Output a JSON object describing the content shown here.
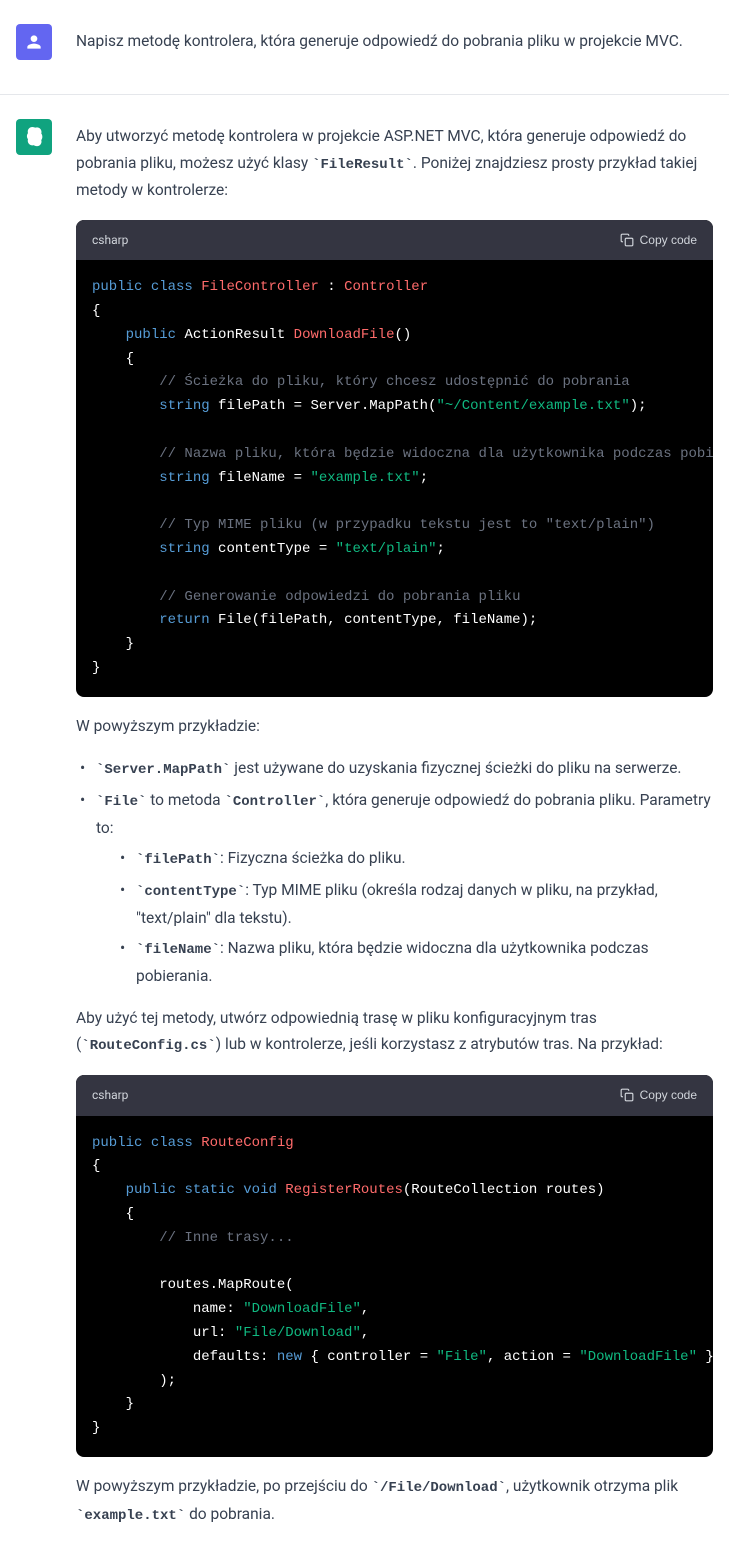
{
  "user": {
    "message": "Napisz metodę kontrolera, która generuje odpowiedź do pobrania pliku w projekcie MVC."
  },
  "assistant": {
    "intro_p1_a": "Aby utworzyć metodę kontrolera w projekcie ASP.NET MVC, która generuje odpowiedź do pobrania pliku, możesz użyć klasy ",
    "intro_p1_code": "`FileResult`",
    "intro_p1_b": ". Poniżej znajdziesz prosty przykład takiej metody w kontrolerze:",
    "code1_lang": "csharp",
    "copy_label": "Copy code",
    "p_after_code1": "W powyższym przykładzie:",
    "bullet1_code": "`Server.MapPath`",
    "bullet1_text": " jest używane do uzyskania fizycznej ścieżki do pliku na serwerze.",
    "bullet2_code": "`File`",
    "bullet2_text_a": " to metoda ",
    "bullet2_code2": "`Controller`",
    "bullet2_text_b": ", która generuje odpowiedź do pobrania pliku. Parametry to:",
    "sub1_code": "`filePath`",
    "sub1_text": ": Fizyczna ścieżka do pliku.",
    "sub2_code": "`contentType`",
    "sub2_text": ": Typ MIME pliku (określa rodzaj danych w pliku, na przykład, \"text/plain\" dla tekstu).",
    "sub3_code": "`fileName`",
    "sub3_text": ": Nazwa pliku, która będzie widoczna dla użytkownika podczas pobierania.",
    "p_before_code2_a": "Aby użyć tej metody, utwórz odpowiednią trasę w pliku konfiguracyjnym tras (",
    "p_before_code2_code": "`RouteConfig.cs`",
    "p_before_code2_b": ") lub w kontrolerze, jeśli korzystasz z atrybutów tras. Na przykład:",
    "code2_lang": "csharp",
    "p_final_a": "W powyższym przykładzie, po przejściu do ",
    "p_final_code1": "`/File/Download`",
    "p_final_b": ", użytkownik otrzyma plik ",
    "p_final_code2": "`example.txt`",
    "p_final_c": " do pobrania.",
    "code1": {
      "c1": "public",
      "c2": "class",
      "c3": "FileController",
      "c4": "Controller",
      "c5": "public",
      "c6": "ActionResult",
      "c7": "DownloadFile",
      "c8": "// Ścieżka do pliku, który chcesz udostępnić do pobrania",
      "c9": "string",
      "c10": "filePath = Server.MapPath(",
      "c11": "\"~/Content/example.txt\"",
      "c12": ");",
      "c13": "// Nazwa pliku, która będzie widoczna dla użytkownika podczas pobierania",
      "c14": "string",
      "c15": "fileName =",
      "c16": "\"example.txt\"",
      "c17": ";",
      "c18": "// Typ MIME pliku (w przypadku tekstu jest to \"text/plain\")",
      "c19": "string",
      "c20": "contentType =",
      "c21": "\"text/plain\"",
      "c22": ";",
      "c23": "// Generowanie odpowiedzi do pobrania pliku",
      "c24": "return",
      "c25": "File(filePath, contentType, fileName);"
    },
    "code2": {
      "c1": "public",
      "c2": "class",
      "c3": "RouteConfig",
      "c4": "public",
      "c5": "static",
      "c6": "void",
      "c7": "RegisterRoutes",
      "c8": "(RouteCollection routes)",
      "c9": "// Inne trasy...",
      "c10": "routes.MapRoute(",
      "c11": "name:",
      "c12": "\"DownloadFile\"",
      "c13": ",",
      "c14": "url:",
      "c15": "\"File/Download\"",
      "c16": ",",
      "c17": "defaults:",
      "c18": "new",
      "c19": "{ controller =",
      "c20": "\"File\"",
      "c21": ", action =",
      "c22": "\"DownloadFile\"",
      "c23": "}",
      "c24": ");"
    }
  }
}
